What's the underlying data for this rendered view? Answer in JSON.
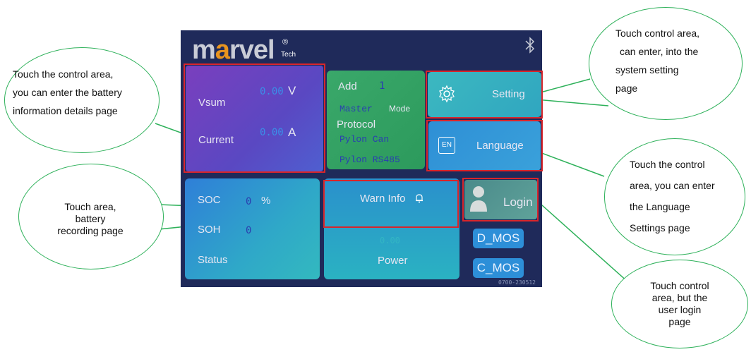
{
  "logo": {
    "main": "marvel",
    "a_letter": "a",
    "tech": "Tech",
    "reg_mark": "®"
  },
  "battery_tile": {
    "vsum_label": "Vsum",
    "vsum_value": "0.00",
    "vsum_unit": "V",
    "current_label": "Current",
    "current_value": "0.00",
    "current_unit": "A"
  },
  "protocol_tile": {
    "add_label": "Add",
    "add_value": "1",
    "mode_value": "Master",
    "mode_label": "Mode",
    "protocol_label": "Protocol",
    "protocols": [
      "Pylon Can",
      "Pylon RS485"
    ]
  },
  "setting_tile": {
    "label": "Setting",
    "icon": "gear-icon"
  },
  "language_tile": {
    "label": "Language",
    "badge": "EN"
  },
  "soc_tile": {
    "soc_label": "SOC",
    "soc_value": "0",
    "soc_unit": "%",
    "soh_label": "SOH",
    "soh_value": "0",
    "status_label": "Status"
  },
  "warn_tile": {
    "label": "Warn Info",
    "icon": "bell-icon"
  },
  "power_tile": {
    "label": "Power",
    "value": "0.00"
  },
  "login_tile": {
    "label": "Login",
    "icon": "user-icon"
  },
  "mos": {
    "d_label": "D_MOS",
    "c_label": "C_MOS"
  },
  "version": "0700-230512",
  "bluetooth_icon": "bluetooth-icon",
  "annotations": {
    "left_top": [
      "Touch the control area,",
      "you can enter the battery",
      "information details page"
    ],
    "left_bottom": [
      "Touch area,",
      "battery",
      "recording page"
    ],
    "right_top": [
      "Touch control area,",
      "can enter, into the",
      "system setting",
      "page"
    ],
    "right_mid": [
      "Touch the control",
      "area, you can enter",
      "the Language",
      "Settings page"
    ],
    "right_bottom": [
      "Touch control",
      "area, but the",
      "user login",
      "page"
    ]
  },
  "colors": {
    "screen_bg": "#1f2a5a",
    "highlight": "#d8252b",
    "callout": "#2eb15a",
    "value_blue": "#3a8fe8"
  }
}
